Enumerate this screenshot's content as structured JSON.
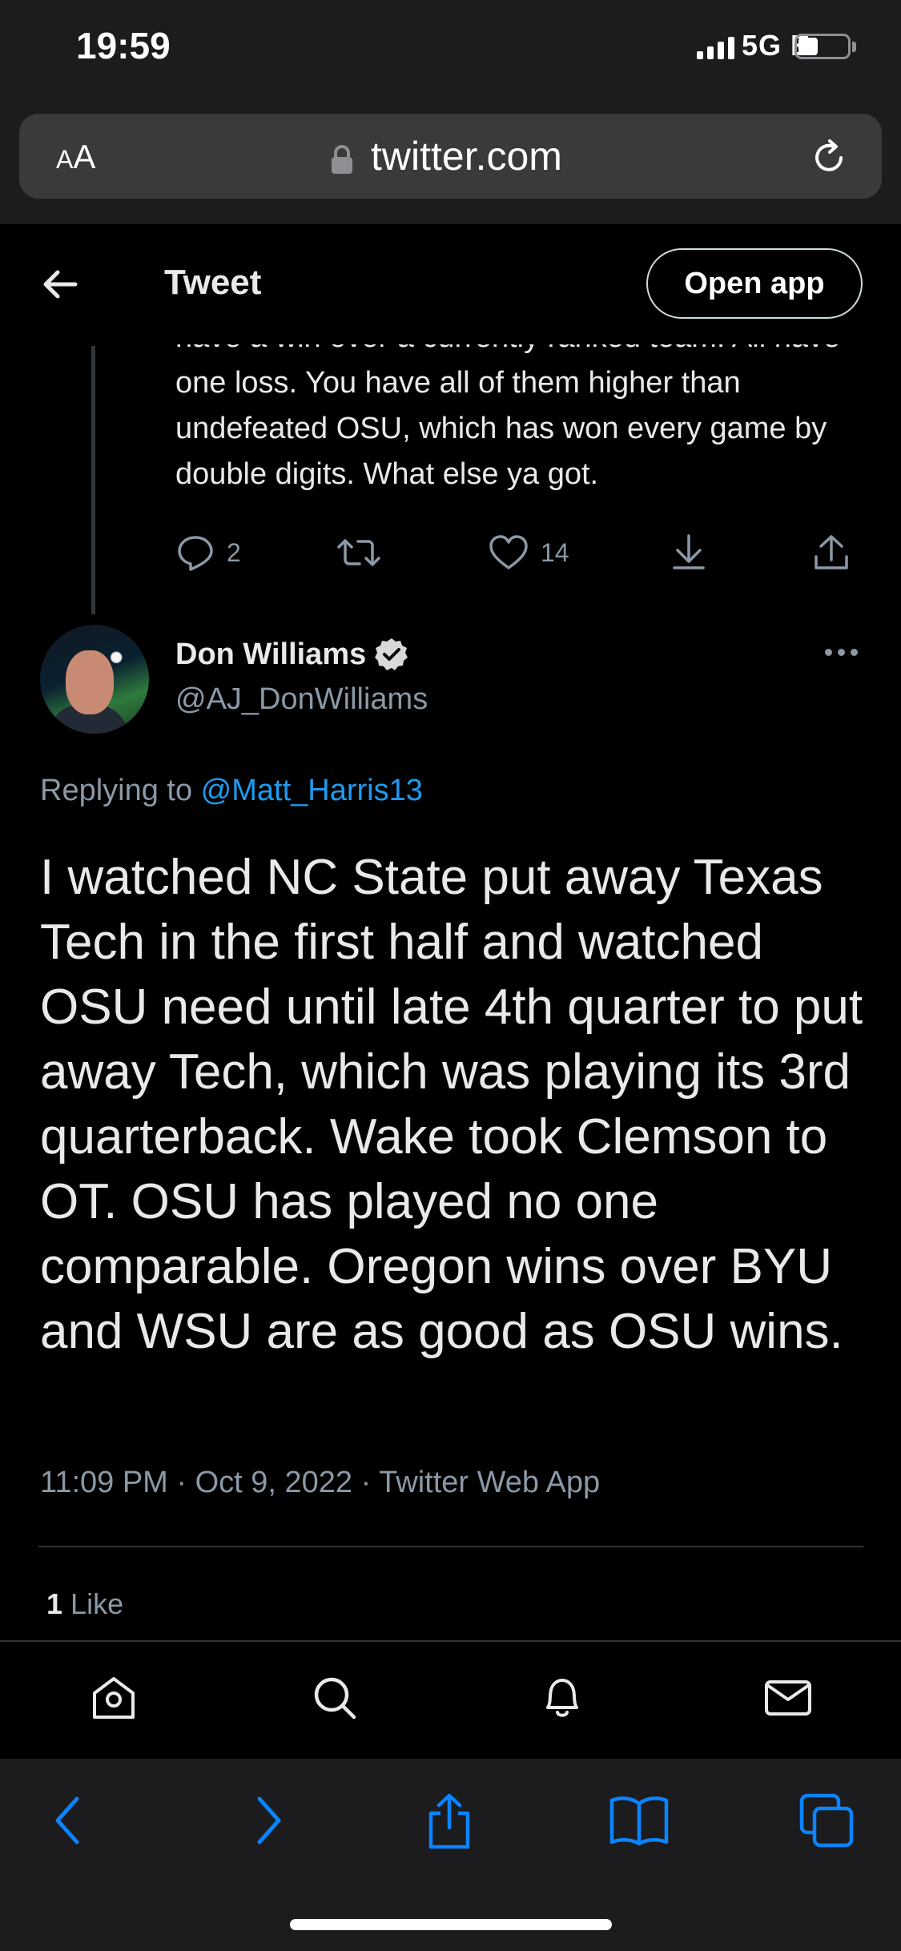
{
  "status_bar": {
    "time": "19:59",
    "network": "5G E"
  },
  "browser": {
    "text_size_label_small": "A",
    "text_size_label_big": "A",
    "url": "twitter.com"
  },
  "header": {
    "title": "Tweet",
    "open_app_label": "Open app"
  },
  "parent_tweet": {
    "text": "have a win over a currently ranked team. All have one loss. You have all of them higher than undefeated OSU, which has won every game by double digits. What else ya got.",
    "reply_count": "2",
    "like_count": "14"
  },
  "tweet": {
    "author_name": "Don Williams",
    "author_handle": "@AJ_DonWilliams",
    "replying_prefix": "Replying to ",
    "replying_to": "@Matt_Harris13",
    "text": "I watched NC State put away Texas Tech in the first half and watched OSU need until late 4th quarter to put away Tech, which was playing its 3rd quarterback. Wake took Clemson to OT. OSU has played no one comparable. Oregon wins over BYU and WSU are as good as OSU wins.",
    "timestamp": "11:09 PM · Oct 9, 2022 · Twitter Web App",
    "likes_count": "1",
    "likes_label": "Like"
  },
  "bottom_nav": {
    "icons": [
      "home-icon",
      "search-icon",
      "notifications-icon",
      "messages-icon"
    ]
  },
  "safari_toolbar": {
    "icons": [
      "back-icon",
      "forward-icon",
      "share-icon",
      "bookmarks-icon",
      "tabs-icon"
    ]
  },
  "colors": {
    "background": "#000000",
    "accent": "#1d9bf0",
    "secondary_text": "#8b98a5",
    "safari_blue": "#0a84ff"
  }
}
